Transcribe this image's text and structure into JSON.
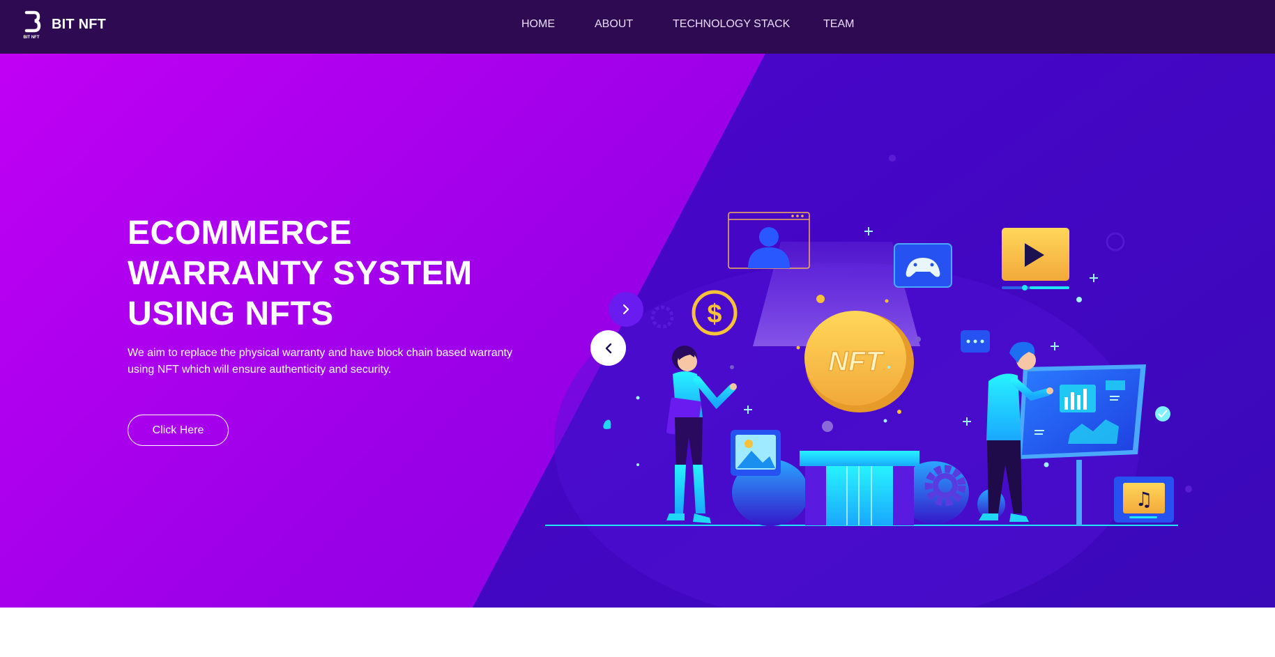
{
  "brand": {
    "name": "BIT NFT",
    "logo_icon": "bitnft-logo-icon"
  },
  "nav": {
    "items": [
      "HOME",
      "ABOUT",
      "TECHNOLOGY STACK",
      "TEAM"
    ]
  },
  "hero": {
    "title_lines": [
      "ECOMMERCE",
      "WARRANTY SYSTEM",
      "USING NFTS"
    ],
    "description": "We aim to replace the physical warranty and have block chain based warranty using NFT which will ensure authenticity and security.",
    "cta_label": "Click Here",
    "illustration": {
      "coin_label": "NFT",
      "dollar_symbol": "$",
      "logo_caption": "BIT NFT"
    }
  },
  "carousel": {
    "prev_icon": "chevron-left-icon",
    "next_icon": "chevron-right-icon"
  },
  "colors": {
    "nav_bg": "#2d0a52",
    "hero_left": "#c000f5",
    "hero_right": "#3e08c8",
    "accent_cyan": "#1ee6f2",
    "coin_gold": "#f7c23a"
  }
}
